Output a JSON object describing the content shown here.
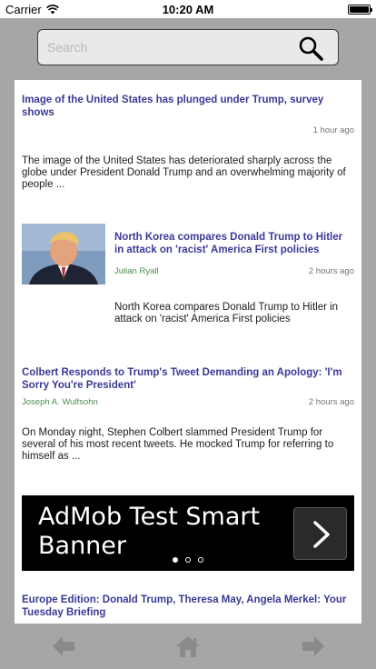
{
  "status_bar": {
    "carrier": "Carrier",
    "time": "10:20 AM",
    "icons": [
      "wifi-icon",
      "battery-icon"
    ]
  },
  "search": {
    "placeholder": "Search",
    "icon": "search-icon"
  },
  "articles": [
    {
      "headline": "Image of the United States has plunged under Trump, survey shows",
      "author": "",
      "time": "1 hour ago",
      "excerpt": "The image of the United States has deteriorated sharply across the globe under President Donald Trump and an overwhelming majority of people ..."
    },
    {
      "headline": "North Korea compares Donald Trump to Hitler in attack on 'racist' America First policies",
      "author": "Julian Ryall",
      "time": "2 hours ago",
      "excerpt": "North Korea compares Donald Trump to Hitler in attack on 'racist' America First policies",
      "thumbnail": "portrait-photo"
    },
    {
      "headline": "Colbert Responds to Trump's Tweet Demanding an Apology: 'I'm Sorry You're President'",
      "author": "Joseph A. Wulfsohn",
      "time": "2 hours ago",
      "excerpt": "On Monday night, Stephen Colbert slammed President Trump for several of his most recent tweets.  He mocked Trump for referring to himself as ..."
    },
    {
      "headline": "Europe Edition: Donald Trump, Theresa May, Angela Merkel: Your Tuesday Briefing",
      "author": "",
      "time": "",
      "excerpt": ""
    }
  ],
  "ad": {
    "text": "AdMob Test Smart Banner",
    "button_icon": "chevron-right-icon",
    "dots": 3,
    "active_dot": 0
  },
  "toolbar": {
    "icons": [
      "back-arrow-icon",
      "home-icon",
      "forward-arrow-icon"
    ]
  },
  "colors": {
    "headline": "#3b3a96",
    "author": "#4f8f4f",
    "background": "#a6a6a6"
  }
}
